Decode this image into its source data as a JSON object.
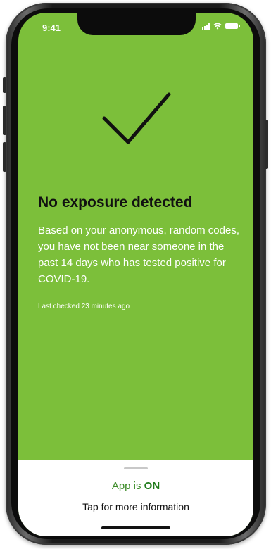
{
  "status_bar": {
    "time": "9:41",
    "icons": [
      "signal-icon",
      "wifi-icon",
      "battery-icon"
    ]
  },
  "main": {
    "icon": "checkmark-icon",
    "title": "No exposure detected",
    "body": "Based on your anonymous, random codes, you have not been near someone in the past 14 days who has tested positive for COVID-19.",
    "last_checked": "Last checked 23 minutes ago"
  },
  "bottom_sheet": {
    "status_prefix": "App is ",
    "status_value": "ON",
    "info_label": "Tap for more information"
  },
  "colors": {
    "background": "#7cbf3a",
    "sheet": "#ffffff",
    "accent": "#3e8c2a"
  }
}
